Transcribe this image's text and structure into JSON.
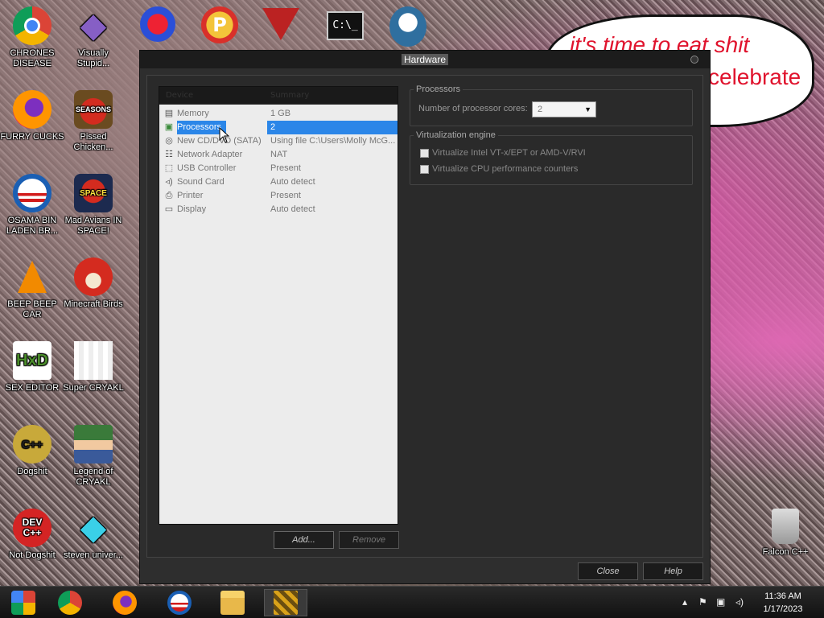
{
  "desktop": {
    "icons": [
      {
        "label": "CHRONES DISEASE",
        "icon": "chrome-icon"
      },
      {
        "label": "Visually Stupid...",
        "icon": "visual-studio-icon"
      },
      {
        "label": "FURRY CUCKS",
        "icon": "firefox-icon"
      },
      {
        "label": "Pissed Chicken...",
        "icon": "angry-birds-seasons-icon"
      },
      {
        "label": "OSAMA BIN LADEN BR...",
        "icon": "obama-logo-icon"
      },
      {
        "label": "Mad Avians IN SPACE!",
        "icon": "angry-birds-space-icon"
      },
      {
        "label": "BEEP BEEP CAR",
        "icon": "vlc-icon"
      },
      {
        "label": "Minecraft Birds",
        "icon": "angry-bird-icon"
      },
      {
        "label": "SEX EDITOR",
        "icon": "hxd-icon"
      },
      {
        "label": "Super CRYAKL",
        "icon": "pixel-character-icon"
      },
      {
        "label": "Dogshit",
        "icon": "dogshit-cpp-icon"
      },
      {
        "label": "Legend of CRYAKL",
        "icon": "pixel-hero-icon"
      },
      {
        "label": "Not Dogshit",
        "icon": "dev-cpp-icon"
      },
      {
        "label": "steven univer...",
        "icon": "diamond-icon"
      },
      {
        "label": "Falcon C++",
        "icon": "recycle-bin-icon"
      }
    ],
    "bubble_line1": "it's time to eat shit",
    "bubble_line2": "celebrate"
  },
  "window": {
    "title": "Hardware",
    "hardware_list": {
      "col_device": "Device",
      "col_summary": "Summary",
      "rows": [
        {
          "device": "Memory",
          "summary": "1 GB",
          "icon": "memory-icon"
        },
        {
          "device": "Processors",
          "summary": "2",
          "icon": "processor-icon",
          "selected": true
        },
        {
          "device": "New CD/DVD (SATA)",
          "summary": "Using file C:\\Users\\Molly McG...",
          "icon": "cd-dvd-icon"
        },
        {
          "device": "Network Adapter",
          "summary": "NAT",
          "icon": "network-adapter-icon"
        },
        {
          "device": "USB Controller",
          "summary": "Present",
          "icon": "usb-icon"
        },
        {
          "device": "Sound Card",
          "summary": "Auto detect",
          "icon": "speaker-icon"
        },
        {
          "device": "Printer",
          "summary": "Present",
          "icon": "printer-icon"
        },
        {
          "device": "Display",
          "summary": "Auto detect",
          "icon": "monitor-icon"
        }
      ]
    },
    "add_label": "Add...",
    "remove_label": "Remove",
    "processors_group": {
      "legend": "Processors",
      "cores_label": "Number of processor cores:",
      "cores_value": "2"
    },
    "virtualization_group": {
      "legend": "Virtualization engine",
      "option1": "Virtualize Intel VT-x/EPT or AMD-V/RVI",
      "option2": "Virtualize CPU performance counters"
    },
    "close_label": "Close",
    "help_label": "Help"
  },
  "taskbar": {
    "time": "11:36 AM",
    "date": "1/17/2023",
    "apps": [
      "chrome-rainbow-icon",
      "chrome-icon",
      "firefox-icon",
      "obama-logo-icon",
      "file-explorer-icon",
      "vmware-icon"
    ]
  }
}
